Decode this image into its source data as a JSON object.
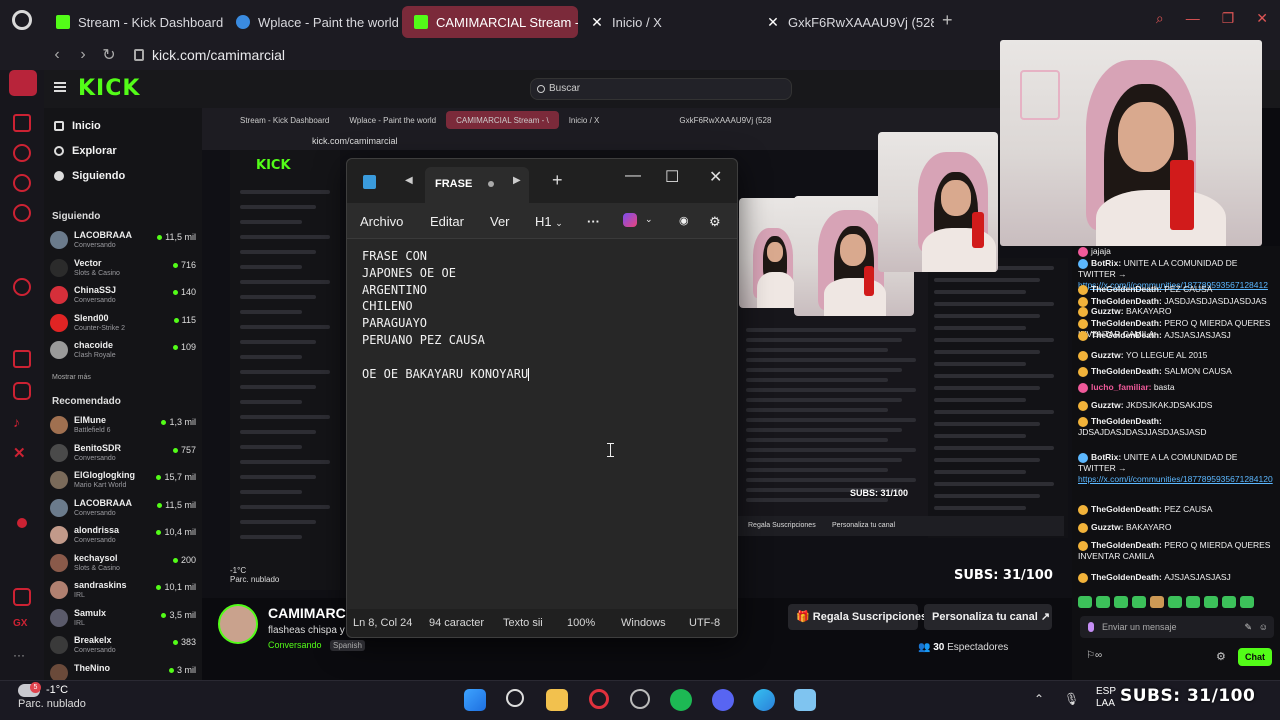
{
  "browser": {
    "tabs": [
      {
        "label": "Stream - Kick Dashboard",
        "color": "#53fc18",
        "active": false
      },
      {
        "label": "Wplace - Paint the world",
        "color": "#3a8be0",
        "active": false
      },
      {
        "label": "CAMIMARCIAL Stream - \\",
        "color": "#53fc18",
        "active": true
      },
      {
        "label": "Inicio / X",
        "color": "#ffffff",
        "active": false
      },
      {
        "label": "GxkF6RwXAAAU9Vj (528",
        "color": "#ffffff",
        "active": false
      }
    ],
    "url": "kick.com/camimarcial"
  },
  "kick": {
    "search_placeholder": "Buscar",
    "nav": {
      "home": "Inicio",
      "explore": "Explorar",
      "following": "Siguiendo"
    },
    "following_title": "Siguiendo",
    "following": [
      {
        "name": "LACOBRAAA",
        "category": "Conversando",
        "viewers": "11,5 mil",
        "color": "#6b7b8c"
      },
      {
        "name": "Vector",
        "category": "Slots & Casino",
        "viewers": "716",
        "color": "#2b2b2b"
      },
      {
        "name": "ChinaSSJ",
        "category": "Conversando",
        "viewers": "140",
        "color": "#d62f3a"
      },
      {
        "name": "Slend00",
        "category": "Counter-Strike 2",
        "viewers": "115",
        "color": "#e02424"
      },
      {
        "name": "chacoide",
        "category": "Clash Royale",
        "viewers": "109",
        "color": "#9a9a9a"
      }
    ],
    "show_more": "Mostrar más",
    "recommended_title": "Recomendado",
    "recommended": [
      {
        "name": "ElMune",
        "category": "Battlefield 6",
        "viewers": "1,3 mil",
        "color": "#a07050"
      },
      {
        "name": "BenitoSDR",
        "category": "Conversando",
        "viewers": "757",
        "color": "#4a4a4a"
      },
      {
        "name": "ElGloglogking",
        "category": "Mario Kart World",
        "viewers": "15,7 mil",
        "color": "#7a6a5a"
      },
      {
        "name": "LACOBRAAA",
        "category": "Conversando",
        "viewers": "11,5 mil",
        "color": "#6b7b8c"
      },
      {
        "name": "alondrissa",
        "category": "Conversando",
        "viewers": "10,4 mil",
        "color": "#c29a8a"
      },
      {
        "name": "kechaysol",
        "category": "Slots & Casino",
        "viewers": "200",
        "color": "#8a5a4a"
      },
      {
        "name": "sandraskins",
        "category": "IRL",
        "viewers": "10,1 mil",
        "color": "#b08070"
      },
      {
        "name": "Samulx",
        "category": "IRL",
        "viewers": "3,5 mil",
        "color": "#5a5a6a"
      },
      {
        "name": "Breakelx",
        "category": "Conversando",
        "viewers": "383",
        "color": "#3a3a3a"
      },
      {
        "name": "TheNino",
        "category": "",
        "viewers": "3 mil",
        "color": "#6a4a3a"
      }
    ],
    "streamer": {
      "name": "CAMIMARCIAL",
      "title": "flasheas chispa y",
      "category": "Conversando",
      "language": "Spanish"
    },
    "subscribe_button": "Regala Suscripciones",
    "customize_button": "Personaliza tu canal",
    "viewers_count": "30",
    "viewers_label": "Espectadores"
  },
  "notepad": {
    "tab_title": "FRASE",
    "menu": {
      "file": "Archivo",
      "edit": "Editar",
      "view": "Ver",
      "heading": "H1"
    },
    "lines": [
      "FRASE CON",
      "JAPONES OE OE",
      "ARGENTINO",
      "CHILENO",
      "PARAGUAYO",
      "PERUANO PEZ CAUSA",
      "",
      "OE OE BAKAYARU KONOYARU"
    ],
    "status": {
      "position": "Ln 8, Col 24",
      "chars": "94 caracter",
      "format": "Texto sii",
      "zoom": "100%",
      "line_ending": "Windows",
      "encoding": "UTF-8"
    }
  },
  "chat": {
    "messages": [
      {
        "user": "",
        "text": "jajaja",
        "y": 0,
        "color": "#f05a9a"
      },
      {
        "user": "BotRix:",
        "text": "UNITE A LA COMUNIDAD DE TWITTER →",
        "link": "https://x.com/i/communities/187789593567128412",
        "color": "#5cb8ff"
      },
      {
        "user": "TheGoldenDeath:",
        "text": "PEZ CAUSA",
        "color": "#f2b33a"
      },
      {
        "user": "TheGoldenDeath:",
        "text": "JASDJASDJASDJASDJAS",
        "color": "#f2b33a"
      },
      {
        "user": "Guzztw:",
        "text": "BAKAYARO",
        "color": "#f2b33a"
      },
      {
        "user": "TheGoldenDeath:",
        "text": "PERO Q MIERDA QUERES INVENTAR CAMILA",
        "color": "#f2b33a"
      },
      {
        "user": "TheGoldenDeath:",
        "text": "AJSJASJASJASJ",
        "color": "#f2b33a"
      },
      {
        "user": "Guzztw:",
        "text": "YO LLEGUE AL 2015",
        "color": "#f2b33a"
      },
      {
        "user": "TheGoldenDeath:",
        "text": "SALMON CAUSA",
        "color": "#f2b33a"
      },
      {
        "user": "lucho_familiar:",
        "text": "basta",
        "color": "#f05a9a"
      },
      {
        "user": "Guzztw:",
        "text": "JKDSJKAKJDSAKJDS",
        "color": "#f2b33a"
      },
      {
        "user": "TheGoldenDeath:",
        "text": "JDSAJDASJDASJJASDJASJASD",
        "color": "#f2b33a"
      },
      {
        "user": "BotRix:",
        "text": "UNITE A LA COMUNIDAD DE TWITTER →",
        "link": "https://x.com/i/communities/1877895935671284120",
        "color": "#5cb8ff"
      },
      {
        "user": "TheGoldenDeath:",
        "text": "PEZ CAUSA",
        "color": "#f2b33a"
      },
      {
        "user": "Guzztw:",
        "text": "BAKAYARO",
        "color": "#f2b33a"
      },
      {
        "user": "TheGoldenDeath:",
        "text": "PERO Q MIERDA QUERES INVENTAR CAMILA",
        "color": "#f2b33a"
      },
      {
        "user": "TheGoldenDeath:",
        "text": "AJSJASJASJASJ",
        "color": "#f2b33a"
      }
    ],
    "input_placeholder": "Enviar un mensaje",
    "send_button": "Chat"
  },
  "taskbar": {
    "weather_temp": "-1°C",
    "weather_desc": "Parc. nublado",
    "weather_badge": "5",
    "language": "ESP\nLAA",
    "subs_overlay": "SUBS: 31/100"
  }
}
